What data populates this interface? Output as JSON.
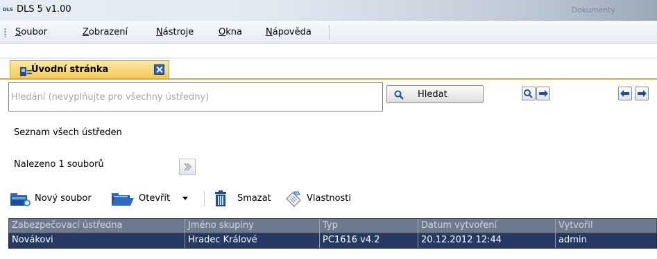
{
  "window": {
    "logo_text": "DLS",
    "title": "DLS 5 v1.00",
    "background_text": "Dokumenty"
  },
  "menu": {
    "items": [
      {
        "label": "Soubor"
      },
      {
        "label": "Zobrazení"
      },
      {
        "label": "Nástroje"
      },
      {
        "label": "Okna"
      },
      {
        "label": "Nápověda"
      }
    ]
  },
  "tabs": [
    {
      "label": "Úvodní stránka"
    }
  ],
  "search": {
    "placeholder": "Hledání (nevyplňujte pro všechny ústředny)",
    "value": "",
    "button_label": "Hledat"
  },
  "list_title": "Seznam všech ústředen",
  "found_count_text": "Nalezeno 1 souborů",
  "toolbar": {
    "new_file_label": "Nový soubor",
    "open_label": "Otevřít",
    "delete_label": "Smazat",
    "properties_label": "Vlastnosti"
  },
  "table": {
    "columns": [
      "Zabezpečovací ústředna",
      "Jméno skupiny",
      "Typ",
      "Datum vytvoření",
      "Vytvořil"
    ],
    "rows": [
      [
        "Novákovi",
        "Hradec Králové",
        "PC1616 v4.2",
        "20.12.2012 12:44",
        "admin"
      ]
    ]
  },
  "colors": {
    "accent_tab": "#f4c957",
    "selected_row": "#253964",
    "header_row": "#6e7b8e"
  }
}
